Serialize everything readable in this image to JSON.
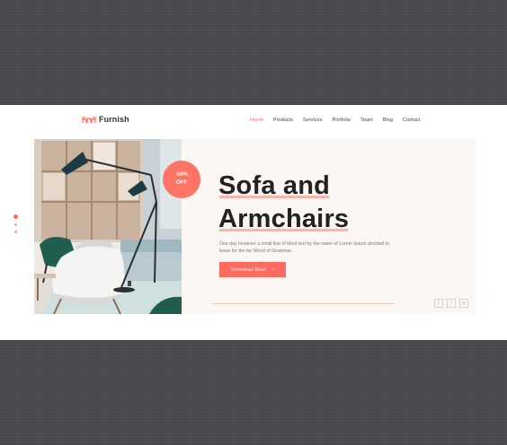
{
  "brand": {
    "name": "Furnish",
    "accent": "#ff6b5e"
  },
  "nav": {
    "items": [
      {
        "label": "Home",
        "active": true
      },
      {
        "label": "Products",
        "active": false
      },
      {
        "label": "Services",
        "active": false
      },
      {
        "label": "Portfolio",
        "active": false
      },
      {
        "label": "Team",
        "active": false
      },
      {
        "label": "Blog",
        "active": false
      },
      {
        "label": "Contact",
        "active": false
      }
    ]
  },
  "hero": {
    "badge_line1": "-50%",
    "badge_line2": "OFF",
    "title_line1": "Sofa and",
    "title_line2": "Armchairs",
    "description": "One day however a small line of blind text by the name of Lorem Ipsum decided to leave for the far World of Grammar.",
    "cta_label": "Download Now!",
    "cta_icon": "chevron-right-icon"
  },
  "socials": [
    {
      "icon": "facebook-icon",
      "glyph": "f"
    },
    {
      "icon": "twitter-icon",
      "glyph": "t"
    },
    {
      "icon": "instagram-icon",
      "glyph": "◎"
    }
  ],
  "slider": {
    "count": 3,
    "active_index": 0
  }
}
